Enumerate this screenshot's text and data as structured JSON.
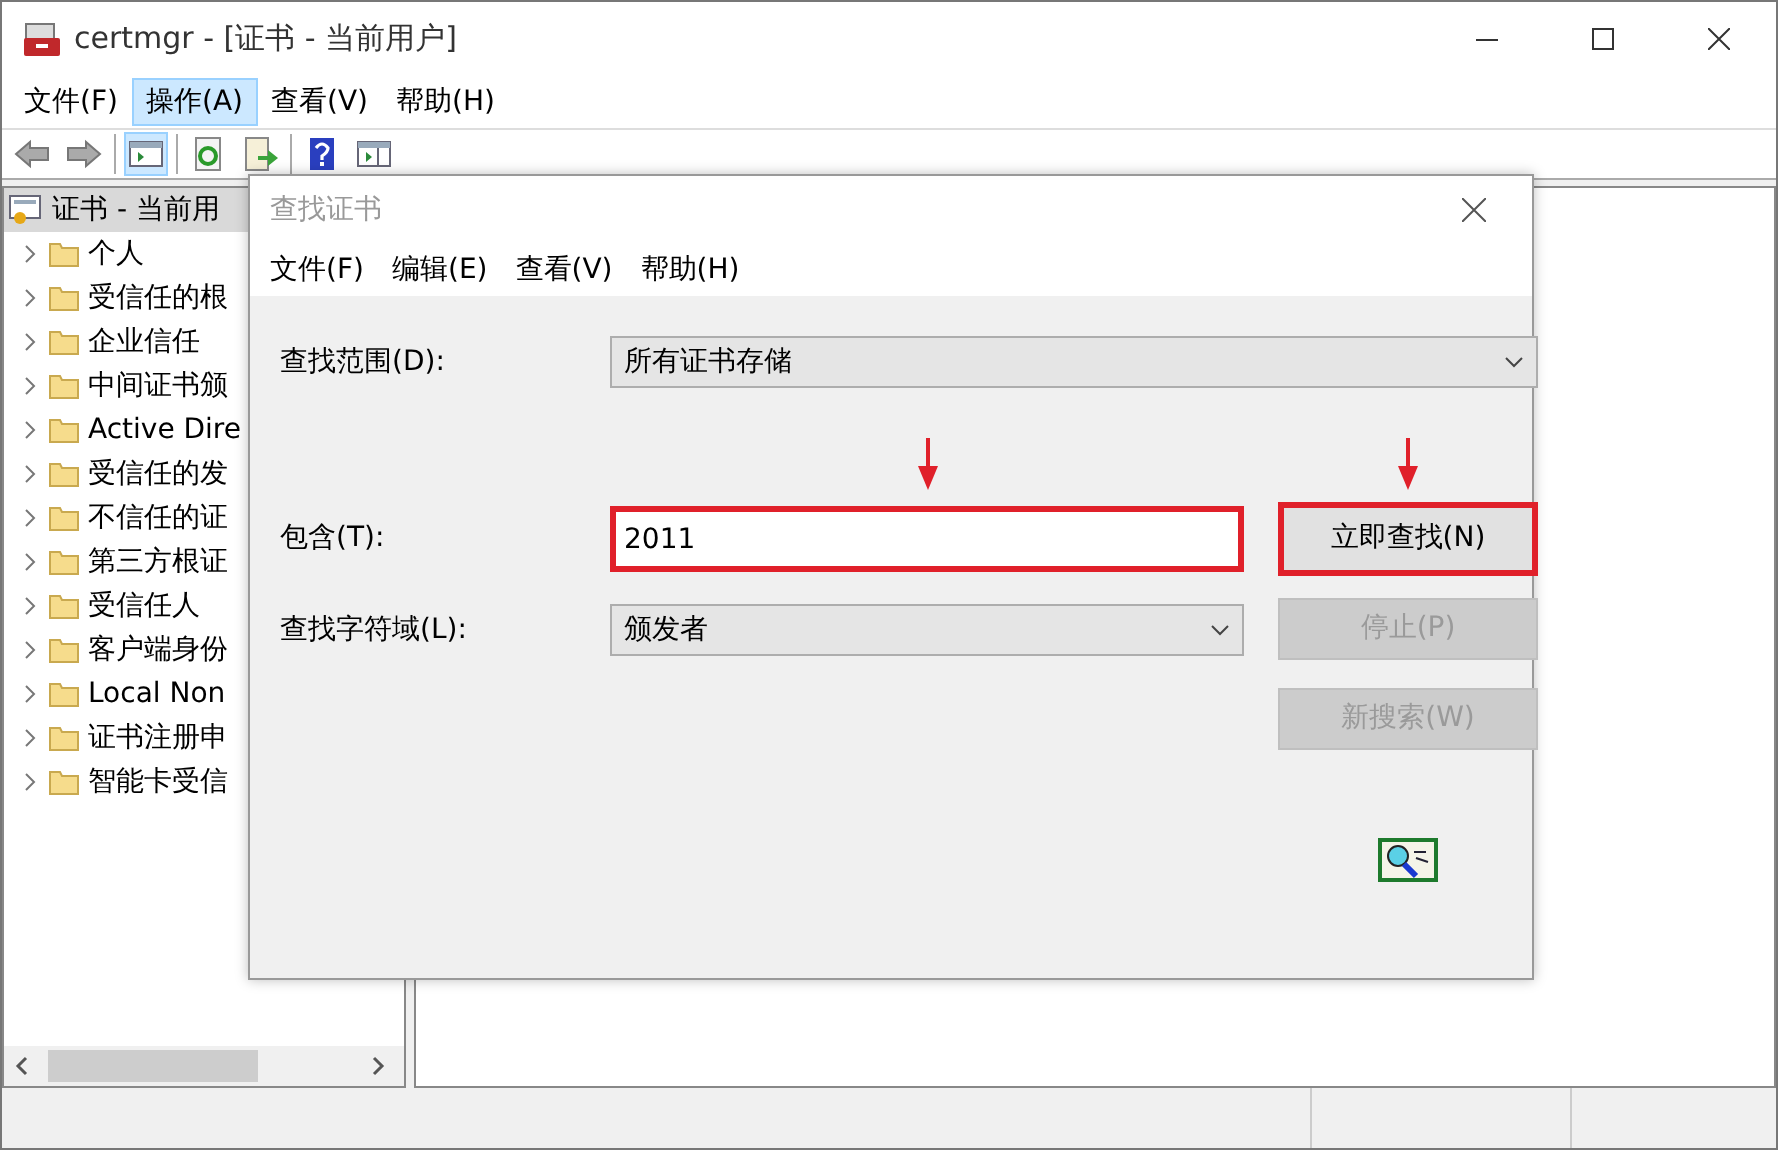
{
  "window": {
    "title": "certmgr - [证书 - 当前用户]"
  },
  "menu": [
    {
      "label": "文件(F)",
      "selected": false
    },
    {
      "label": "操作(A)",
      "selected": true
    },
    {
      "label": "查看(V)",
      "selected": false
    },
    {
      "label": "帮助(H)",
      "selected": false
    }
  ],
  "toolbar": [
    {
      "kind": "back",
      "pressed": false
    },
    {
      "kind": "forward",
      "pressed": false
    },
    {
      "kind": "sep"
    },
    {
      "kind": "tree",
      "pressed": true
    },
    {
      "kind": "sep"
    },
    {
      "kind": "refresh",
      "pressed": false
    },
    {
      "kind": "export",
      "pressed": false
    },
    {
      "kind": "sep"
    },
    {
      "kind": "help",
      "pressed": false
    },
    {
      "kind": "panel",
      "pressed": false
    }
  ],
  "tree": {
    "root": {
      "label": "证书 - 当前用",
      "selected": true
    },
    "items": [
      {
        "label": "个人",
        "expanded": false
      },
      {
        "label": "受信任的根",
        "expanded": false
      },
      {
        "label": "企业信任",
        "expanded": false
      },
      {
        "label": "中间证书颁",
        "expanded": false
      },
      {
        "label": "Active Dire",
        "expanded": false
      },
      {
        "label": "受信任的发",
        "expanded": false
      },
      {
        "label": "不信任的证",
        "expanded": false
      },
      {
        "label": "第三方根证",
        "expanded": false
      },
      {
        "label": "受信任人",
        "expanded": false
      },
      {
        "label": "客户端身份",
        "expanded": false
      },
      {
        "label": "Local Non",
        "expanded": false
      },
      {
        "label": "证书注册申",
        "expanded": false
      },
      {
        "label": "智能卡受信",
        "expanded": false
      }
    ]
  },
  "dialog": {
    "title": "查找证书",
    "menu": [
      {
        "label": "文件(F)",
        "selected": false
      },
      {
        "label": "编辑(E)",
        "selected": false
      },
      {
        "label": "查看(V)",
        "selected": false
      },
      {
        "label": "帮助(H)",
        "selected": false
      }
    ],
    "scope": {
      "label": "查找范围(D):",
      "value": "所有证书存储"
    },
    "contains": {
      "label": "包含(T):",
      "value": "2011",
      "highlighted": true
    },
    "field": {
      "label": "查找字符域(L):",
      "value": "颁发者"
    },
    "buttons": [
      {
        "label": "立即查找(N)",
        "disabled": false,
        "highlighted": true
      },
      {
        "label": "停止(P)",
        "disabled": true,
        "highlighted": false
      },
      {
        "label": "新搜索(W)",
        "disabled": true,
        "highlighted": false
      }
    ]
  }
}
